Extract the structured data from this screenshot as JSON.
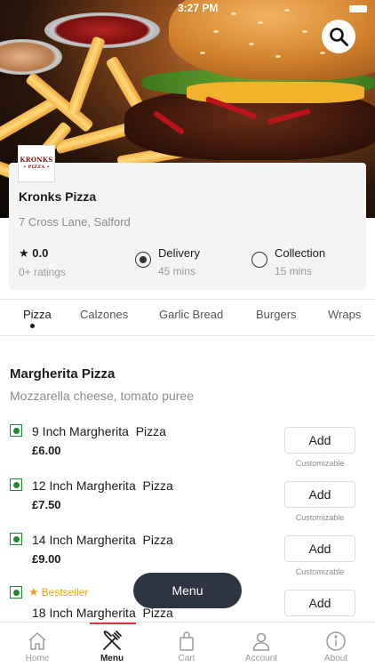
{
  "status_bar": {
    "time": "3:27 PM"
  },
  "restaurant": {
    "logo_text": "KRONKS",
    "logo_sub": "• PIZZA •",
    "name": "Kronks Pizza",
    "address": "7 Cross Lane, Salford",
    "rating": "0.0",
    "ratings_count": "0+ ratings",
    "delivery_label": "Delivery",
    "delivery_time": "45 mins",
    "collection_label": "Collection",
    "collection_time": "15 mins",
    "selected_option": "Delivery"
  },
  "category_tabs": [
    "Pizza",
    "Calzones",
    "Garlic Bread",
    "Burgers",
    "Wraps"
  ],
  "active_tab": "Pizza",
  "section": {
    "title": "Margherita Pizza",
    "description": "Mozzarella cheese, tomato puree"
  },
  "items": [
    {
      "name": "9 Inch Margherita  Pizza",
      "price": "£6.00",
      "button": "Add",
      "note": "Customizable"
    },
    {
      "name": "12 Inch Margherita  Pizza",
      "price": "£7.50",
      "button": "Add",
      "note": "Customizable"
    },
    {
      "name": "14 Inch Margherita  Pizza",
      "price": "£9.00",
      "button": "Add",
      "note": "Customizable"
    },
    {
      "name": "18 Inch Margherita  Pizza",
      "badge": "Bestseller",
      "button": "Add"
    }
  ],
  "floating_menu_label": "Menu",
  "bottom_nav": [
    {
      "label": "Home",
      "icon": "home-icon"
    },
    {
      "label": "Menu",
      "icon": "fork-knife-icon",
      "active": true
    },
    {
      "label": "Cart",
      "icon": "shopping-bag-icon"
    },
    {
      "label": "Account",
      "icon": "user-icon"
    },
    {
      "label": "About",
      "icon": "info-icon"
    }
  ],
  "colors": {
    "accent": "#e0304a",
    "veg_green": "#1e8a2e",
    "bestseller": "#e8a21c",
    "fab": "#2f3442"
  }
}
